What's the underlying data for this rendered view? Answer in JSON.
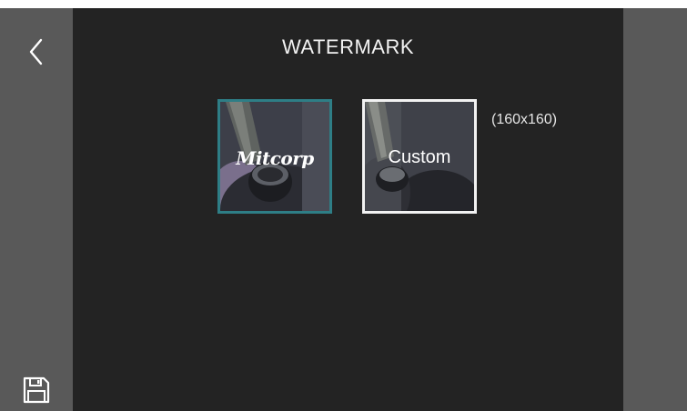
{
  "header": {
    "title": "WATERMARK"
  },
  "nav": {
    "back_icon": "chevron-left-icon",
    "save_icon": "floppy-disk-icon"
  },
  "watermarks": [
    {
      "label": "Mitcorp",
      "selected": true
    },
    {
      "label": "Custom",
      "selected": false
    }
  ],
  "custom_size": "(160x160)",
  "colors": {
    "background": "#232323",
    "sidebar": "#595959",
    "selected_border": "#2e7e86",
    "unselected_border": "#f2f2f2"
  }
}
